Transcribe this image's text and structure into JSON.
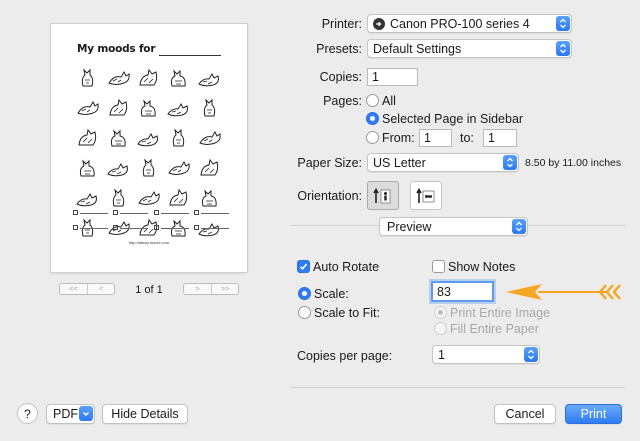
{
  "preview": {
    "title": "My moods for",
    "url": "http://sticky.mochi.com",
    "page_count": "1 of 1",
    "nav": {
      "first": "<<",
      "prev": "<",
      "next": ">",
      "last": ">>"
    }
  },
  "printer": {
    "label": "Printer:",
    "value": "Canon PRO-100 series 4",
    "icon": "printer-icon"
  },
  "presets": {
    "label": "Presets:",
    "value": "Default Settings"
  },
  "copies": {
    "label": "Copies:",
    "value": "1"
  },
  "pages": {
    "label": "Pages:",
    "all": "All",
    "selected": "Selected Page in Sidebar",
    "from_label": "From:",
    "from_value": "1",
    "to_label": "to:",
    "to_value": "1",
    "current": "selected"
  },
  "paper_size": {
    "label": "Paper Size:",
    "value": "US Letter",
    "dimensions": "8.50 by 11.00 inches"
  },
  "orientation": {
    "label": "Orientation:",
    "current": "portrait"
  },
  "section": {
    "value": "Preview"
  },
  "options": {
    "auto_rotate": "Auto Rotate",
    "auto_rotate_checked": true,
    "show_notes": "Show Notes",
    "show_notes_checked": false,
    "scale": "Scale:",
    "scale_value": "83",
    "scale_to_fit": "Scale to Fit:",
    "print_entire_image": "Print Entire Image",
    "fill_entire_paper": "Fill Entire Paper",
    "copies_per_page": "Copies per page:",
    "copies_per_page_value": "1"
  },
  "footer": {
    "help": "?",
    "pdf": "PDF",
    "hide_details": "Hide Details",
    "cancel": "Cancel",
    "print": "Print"
  },
  "colors": {
    "accent": "#2f7cf3",
    "annotation_arrow": "#f5a623"
  }
}
